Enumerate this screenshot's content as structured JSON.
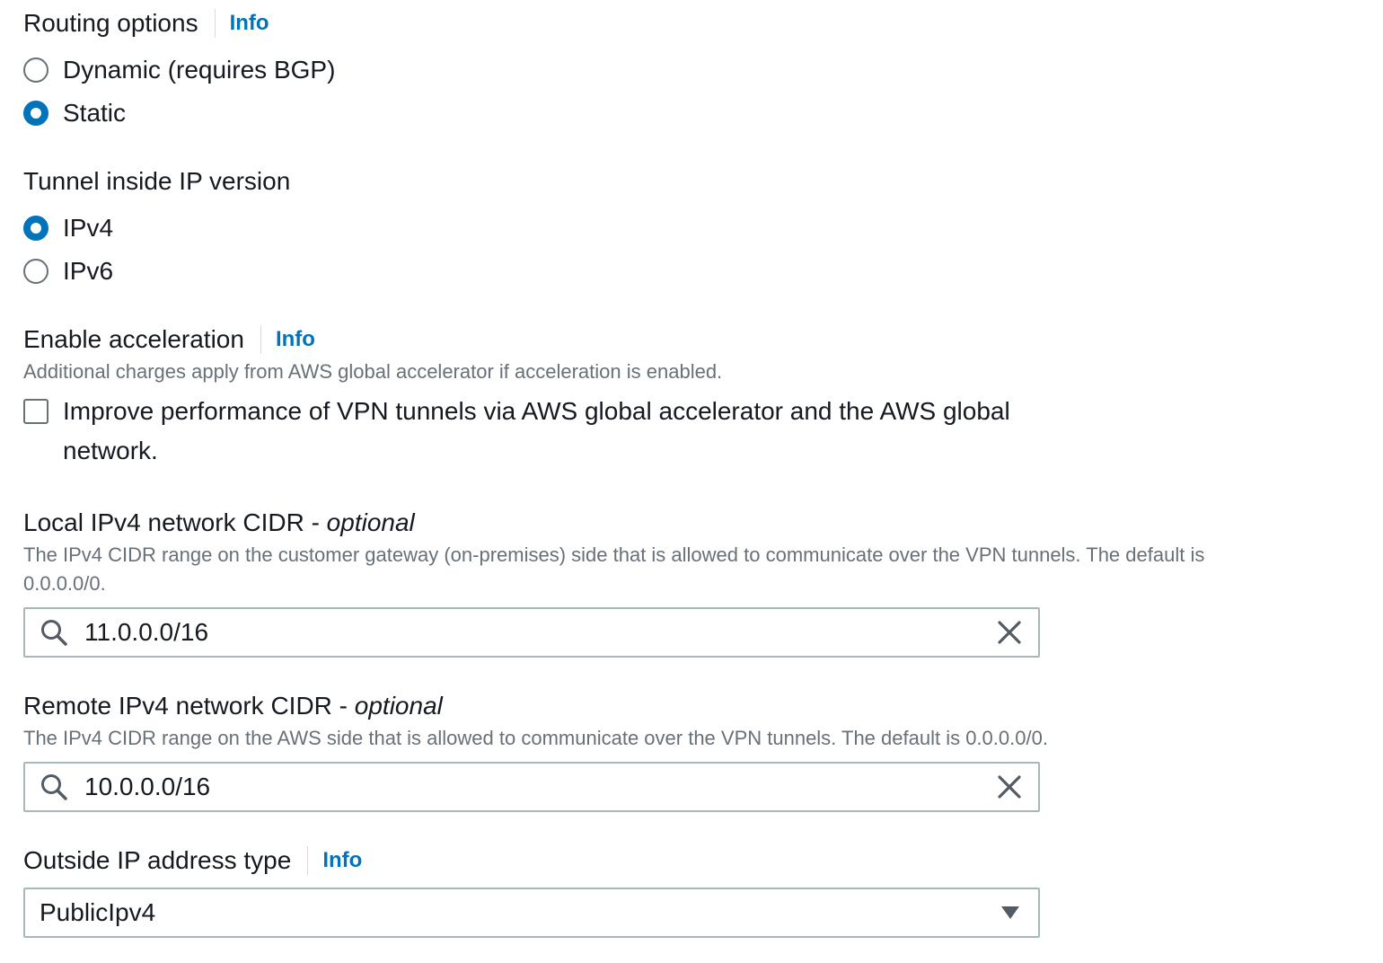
{
  "routing": {
    "label": "Routing options",
    "info": "Info",
    "options": [
      {
        "label": "Dynamic (requires BGP)",
        "checked": false
      },
      {
        "label": "Static",
        "checked": true
      }
    ]
  },
  "tunnel_ip": {
    "label": "Tunnel inside IP version",
    "options": [
      {
        "label": "IPv4",
        "checked": true
      },
      {
        "label": "IPv6",
        "checked": false
      }
    ]
  },
  "acceleration": {
    "label": "Enable acceleration",
    "info": "Info",
    "description": "Additional charges apply from AWS global accelerator if acceleration is enabled.",
    "checkbox_label_line1": "Improve performance of VPN tunnels via AWS global accelerator and the AWS global",
    "checkbox_label_line2": "network.",
    "checked": false
  },
  "local_cidr": {
    "label": "Local IPv4 network CIDR - ",
    "optional": "optional",
    "description_line1": "The IPv4 CIDR range on the customer gateway (on-premises) side that is allowed to communicate over the VPN tunnels. The default is",
    "description_line2": "0.0.0.0/0.",
    "value": "11.0.0.0/16"
  },
  "remote_cidr": {
    "label": "Remote IPv4 network CIDR - ",
    "optional": "optional",
    "description": "The IPv4 CIDR range on the AWS side that is allowed to communicate over the VPN tunnels. The default is 0.0.0.0/0.",
    "value": "10.0.0.0/16"
  },
  "outside_ip": {
    "label": "Outside IP address type",
    "info": "Info",
    "selected": "PublicIpv4"
  },
  "colors": {
    "accent": "#0073bb",
    "text": "#16191f",
    "secondary_text": "#687078",
    "border": "#aab7b8"
  },
  "icons": {
    "search": "search-icon",
    "clear": "close-icon",
    "dropdown": "caret-down-icon"
  }
}
